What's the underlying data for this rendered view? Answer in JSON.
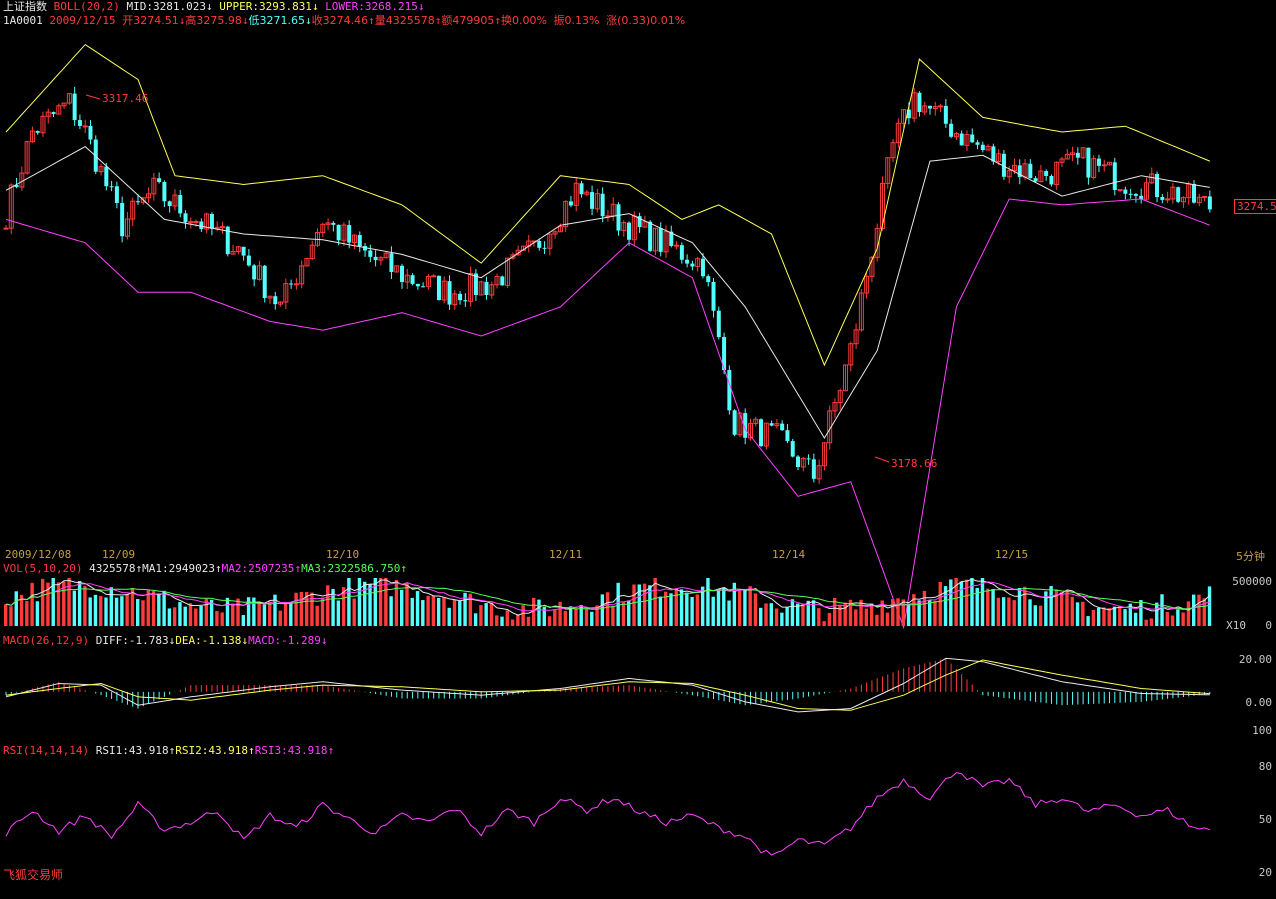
{
  "header": {
    "index_name": "上证指数",
    "boll_label": "BOLL(20,2)",
    "mid": "MID:3281.023",
    "upper": "UPPER:3293.831",
    "lower": "LOWER:3268.215",
    "code": "1A0001",
    "date": "2009/12/15",
    "open": "开3274.51",
    "high": "高3275.98",
    "low": "低3271.65",
    "close": "收3274.46",
    "volume": "量4325578",
    "amount": "额479905",
    "turnover": "换0.00%",
    "amplitude": "振0.13%",
    "change": "涨(0.33)0.01%"
  },
  "price_annotations": {
    "high_mark": "3317.46",
    "low_mark": "3178.66",
    "last_price": "3274.5"
  },
  "date_axis": [
    "2009/12/08",
    "12/09",
    "12/10",
    "12/11",
    "12/14",
    "12/15"
  ],
  "period": "5分钟",
  "volume_panel": {
    "label": "VOL(5,10,20)",
    "value": "4325578",
    "ma1": "MA1:2949023",
    "ma2": "MA2:2507235",
    "ma3": "MA3:2322586.750",
    "axis_top": "500000",
    "axis_unit": "X10",
    "axis_zero": "0"
  },
  "macd_panel": {
    "label": "MACD(26,12,9)",
    "diff": "DIFF:-1.783",
    "dea": "DEA:-1.138",
    "macd": "MACD:-1.289",
    "axis": [
      "20.00",
      "0.00",
      "100"
    ]
  },
  "rsi_panel": {
    "label": "RSI(14,14,14)",
    "rsi1": "RSI1:43.918",
    "rsi2": "RSI2:43.918",
    "rsi3": "RSI3:43.918",
    "axis": [
      "80",
      "50",
      "20"
    ]
  },
  "footer": "飞狐交易师",
  "colors": {
    "up": "#ff3b3b",
    "down": "#54ffff",
    "mid": "#e8e8e8",
    "upper": "#ffff54",
    "lower": "#ff40ff",
    "rsi": "#ff40ff"
  },
  "chart_data": [
    {
      "type": "candlestick",
      "title": "上证指数 BOLL(20,2)",
      "interval": "5分钟",
      "x_labels": [
        "2009/12/08",
        "12/09",
        "12/10",
        "12/11",
        "12/14",
        "12/15"
      ],
      "ylim": [
        3160,
        3335
      ],
      "close_anchors": [
        {
          "bar": 0,
          "close": 3272
        },
        {
          "bar": 5,
          "close": 3300
        },
        {
          "bar": 12,
          "close": 3310
        },
        {
          "bar": 15,
          "close": 3300
        },
        {
          "bar": 22,
          "close": 3268
        },
        {
          "bar": 28,
          "close": 3280
        },
        {
          "bar": 36,
          "close": 3270
        },
        {
          "bar": 44,
          "close": 3260
        },
        {
          "bar": 52,
          "close": 3240
        },
        {
          "bar": 60,
          "close": 3270
        },
        {
          "bar": 68,
          "close": 3258
        },
        {
          "bar": 76,
          "close": 3250
        },
        {
          "bar": 84,
          "close": 3245
        },
        {
          "bar": 92,
          "close": 3248
        },
        {
          "bar": 100,
          "close": 3260
        },
        {
          "bar": 108,
          "close": 3280
        },
        {
          "bar": 116,
          "close": 3270
        },
        {
          "bar": 124,
          "close": 3262
        },
        {
          "bar": 132,
          "close": 3255
        },
        {
          "bar": 138,
          "close": 3200
        },
        {
          "bar": 146,
          "close": 3195
        },
        {
          "bar": 153,
          "close": 3182
        },
        {
          "bar": 160,
          "close": 3225
        },
        {
          "bar": 168,
          "close": 3295
        },
        {
          "bar": 172,
          "close": 3312
        },
        {
          "bar": 180,
          "close": 3300
        },
        {
          "bar": 188,
          "close": 3290
        },
        {
          "bar": 196,
          "close": 3285
        },
        {
          "bar": 204,
          "close": 3290
        },
        {
          "bar": 212,
          "close": 3283
        },
        {
          "bar": 220,
          "close": 3280
        },
        {
          "bar": 228,
          "close": 3274.46
        }
      ],
      "bands": {
        "upper": [
          [
            0,
            3300
          ],
          [
            15,
            3330
          ],
          [
            25,
            3318
          ],
          [
            32,
            3285
          ],
          [
            45,
            3282
          ],
          [
            60,
            3285
          ],
          [
            75,
            3275
          ],
          [
            90,
            3255
          ],
          [
            105,
            3285
          ],
          [
            118,
            3282
          ],
          [
            128,
            3270
          ],
          [
            135,
            3275
          ],
          [
            145,
            3265
          ],
          [
            155,
            3220
          ],
          [
            165,
            3260
          ],
          [
            173,
            3325
          ],
          [
            185,
            3305
          ],
          [
            200,
            3300
          ],
          [
            212,
            3302
          ],
          [
            228,
            3290
          ]
        ],
        "mid": [
          [
            0,
            3280
          ],
          [
            15,
            3295
          ],
          [
            30,
            3270
          ],
          [
            45,
            3265
          ],
          [
            60,
            3263
          ],
          [
            75,
            3258
          ],
          [
            90,
            3250
          ],
          [
            105,
            3268
          ],
          [
            118,
            3272
          ],
          [
            130,
            3262
          ],
          [
            140,
            3240
          ],
          [
            155,
            3195
          ],
          [
            165,
            3225
          ],
          [
            175,
            3290
          ],
          [
            185,
            3292
          ],
          [
            200,
            3278
          ],
          [
            215,
            3285
          ],
          [
            228,
            3281
          ]
        ],
        "lower": [
          [
            0,
            3270
          ],
          [
            15,
            3262
          ],
          [
            25,
            3245
          ],
          [
            35,
            3245
          ],
          [
            50,
            3235
          ],
          [
            60,
            3232
          ],
          [
            75,
            3238
          ],
          [
            90,
            3230
          ],
          [
            105,
            3240
          ],
          [
            118,
            3262
          ],
          [
            130,
            3250
          ],
          [
            140,
            3198
          ],
          [
            150,
            3175
          ],
          [
            160,
            3180
          ],
          [
            170,
            3130
          ],
          [
            180,
            3240
          ],
          [
            190,
            3277
          ],
          [
            200,
            3275
          ],
          [
            215,
            3277
          ],
          [
            228,
            3268
          ]
        ]
      },
      "extremes": {
        "high": 3317.46,
        "low": 3178.66
      },
      "last": 3274.5
    },
    {
      "type": "bar",
      "title": "VOL(5,10,20)",
      "last_value": 4325578,
      "ma": {
        "MA1": 2949023,
        "MA2": 2507235,
        "MA3": 2322586.75
      },
      "axis_labels": [
        "500000",
        "X10",
        "0"
      ]
    },
    {
      "type": "bar",
      "title": "MACD(26,12,9)",
      "values": {
        "DIFF": -1.783,
        "DEA": -1.138,
        "MACD": -1.289
      },
      "ylim": [
        -30,
        25
      ],
      "diff_path": [
        [
          0,
          -3
        ],
        [
          10,
          5
        ],
        [
          18,
          4
        ],
        [
          25,
          -8
        ],
        [
          35,
          -3
        ],
        [
          50,
          3
        ],
        [
          60,
          6
        ],
        [
          75,
          1
        ],
        [
          90,
          -2
        ],
        [
          105,
          2
        ],
        [
          118,
          8
        ],
        [
          130,
          4
        ],
        [
          140,
          -6
        ],
        [
          150,
          -12
        ],
        [
          160,
          -10
        ],
        [
          170,
          5
        ],
        [
          178,
          20
        ],
        [
          185,
          18
        ],
        [
          200,
          6
        ],
        [
          215,
          -1
        ],
        [
          228,
          -1.783
        ]
      ],
      "dea_path": [
        [
          0,
          -2
        ],
        [
          10,
          2
        ],
        [
          18,
          5
        ],
        [
          25,
          -3
        ],
        [
          35,
          -5
        ],
        [
          50,
          1
        ],
        [
          60,
          4
        ],
        [
          75,
          3
        ],
        [
          90,
          0
        ],
        [
          105,
          1
        ],
        [
          118,
          6
        ],
        [
          130,
          5
        ],
        [
          140,
          -2
        ],
        [
          150,
          -10
        ],
        [
          160,
          -11
        ],
        [
          170,
          -2
        ],
        [
          178,
          10
        ],
        [
          185,
          19
        ],
        [
          200,
          10
        ],
        [
          215,
          2
        ],
        [
          228,
          -1.138
        ]
      ]
    },
    {
      "type": "line",
      "title": "RSI(14,14,14)",
      "values": {
        "RSI1": 43.918,
        "RSI2": 43.918,
        "RSI3": 43.918
      },
      "ylim": [
        20,
        80
      ],
      "points": [
        [
          0,
          42
        ],
        [
          5,
          55
        ],
        [
          10,
          43
        ],
        [
          15,
          52
        ],
        [
          20,
          40
        ],
        [
          25,
          58
        ],
        [
          30,
          44
        ],
        [
          35,
          48
        ],
        [
          40,
          55
        ],
        [
          45,
          38
        ],
        [
          50,
          52
        ],
        [
          55,
          45
        ],
        [
          60,
          58
        ],
        [
          65,
          50
        ],
        [
          70,
          42
        ],
        [
          75,
          52
        ],
        [
          80,
          48
        ],
        [
          85,
          56
        ],
        [
          90,
          42
        ],
        [
          95,
          55
        ],
        [
          100,
          48
        ],
        [
          105,
          62
        ],
        [
          110,
          55
        ],
        [
          115,
          62
        ],
        [
          120,
          54
        ],
        [
          125,
          48
        ],
        [
          130,
          52
        ],
        [
          135,
          45
        ],
        [
          140,
          40
        ],
        [
          145,
          28
        ],
        [
          150,
          38
        ],
        [
          155,
          35
        ],
        [
          160,
          45
        ],
        [
          165,
          62
        ],
        [
          170,
          72
        ],
        [
          175,
          62
        ],
        [
          180,
          78
        ],
        [
          185,
          68
        ],
        [
          190,
          72
        ],
        [
          195,
          58
        ],
        [
          200,
          62
        ],
        [
          205,
          54
        ],
        [
          210,
          58
        ],
        [
          215,
          52
        ],
        [
          220,
          55
        ],
        [
          225,
          45
        ],
        [
          228,
          43.918
        ]
      ]
    }
  ]
}
